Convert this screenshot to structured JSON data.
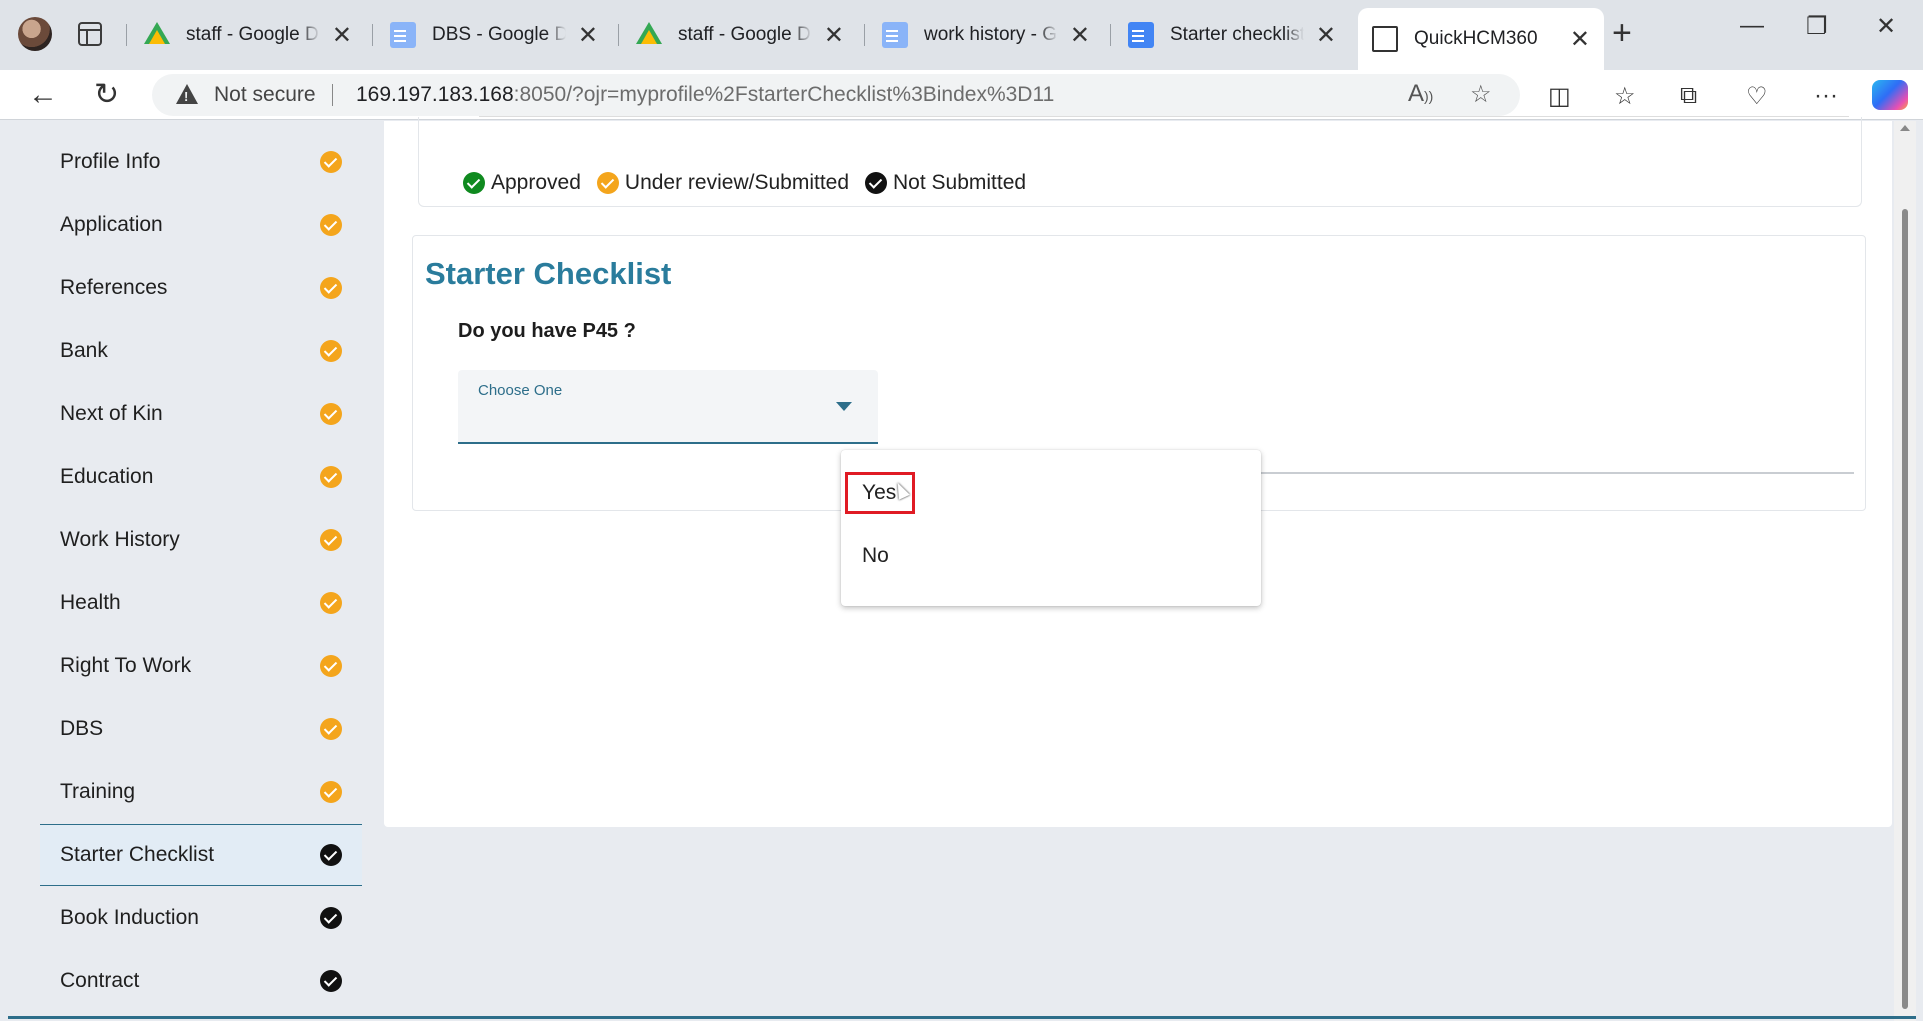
{
  "browser": {
    "tabs": [
      {
        "title": "staff - Google Drive",
        "icon": "google-drive-icon"
      },
      {
        "title": "DBS - Google Docs",
        "icon": "google-docs-icon"
      },
      {
        "title": "staff - Google Drive",
        "icon": "google-drive-icon"
      },
      {
        "title": "work history - Google Docs",
        "icon": "google-docs-icon"
      },
      {
        "title": "Starter checklist - Google Docs",
        "icon": "google-docs-icon"
      },
      {
        "title": "QuickHCM360",
        "icon": "page-icon",
        "active": true
      }
    ],
    "address": {
      "security_label": "Not secure",
      "url_host": "169.197.183.168",
      "url_rest": ":8050/?ojr=myprofile%2FstarterChecklist%3Bindex%3D11"
    }
  },
  "sidebar": {
    "items": [
      {
        "label": "Profile Info",
        "status": "submitted"
      },
      {
        "label": "Application",
        "status": "submitted"
      },
      {
        "label": "References",
        "status": "submitted"
      },
      {
        "label": "Bank",
        "status": "submitted"
      },
      {
        "label": "Next of Kin",
        "status": "submitted"
      },
      {
        "label": "Education",
        "status": "submitted"
      },
      {
        "label": "Work History",
        "status": "submitted"
      },
      {
        "label": "Health",
        "status": "submitted"
      },
      {
        "label": "Right To Work",
        "status": "submitted"
      },
      {
        "label": "DBS",
        "status": "submitted"
      },
      {
        "label": "Training",
        "status": "submitted"
      },
      {
        "label": "Starter Checklist",
        "status": "not-submitted",
        "active": true
      },
      {
        "label": "Book Induction",
        "status": "not-submitted"
      },
      {
        "label": "Contract",
        "status": "not-submitted"
      }
    ]
  },
  "legend": {
    "approved": "Approved",
    "submitted": "Under review/Submitted",
    "not_submitted": "Not Submitted"
  },
  "checklist": {
    "title": "Starter Checklist",
    "question": "Do you have P45 ?",
    "select_label": "Choose One",
    "options": [
      "Yes",
      "No"
    ]
  },
  "colors": {
    "accent": "#2a7c9c",
    "approved": "#0f8a1f",
    "submitted": "#f4a51c",
    "not_submitted": "#111111",
    "highlight": "#e01b24"
  }
}
